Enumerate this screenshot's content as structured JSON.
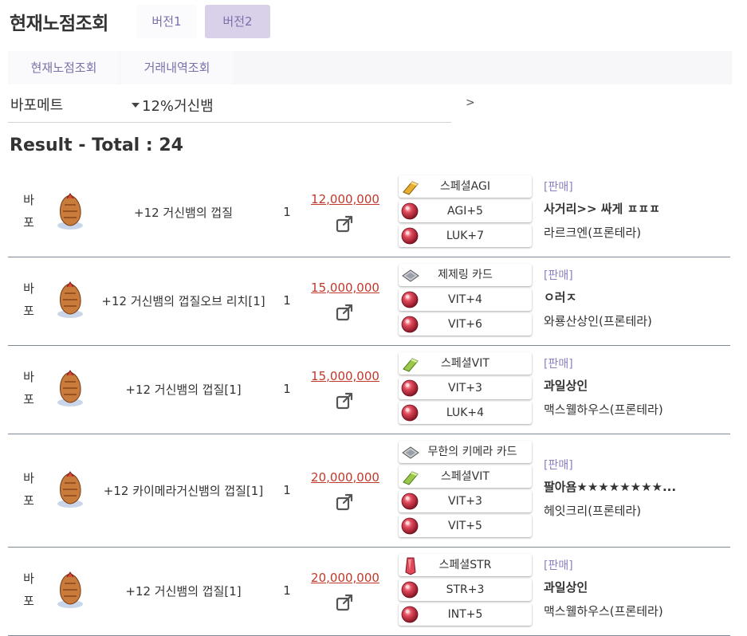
{
  "header": {
    "title": "현재노점조회",
    "version_buttons": [
      "버전1",
      "버전2"
    ]
  },
  "subtabs": [
    "현재노점조회",
    "거래내역조회"
  ],
  "search": {
    "server": "바포메트",
    "query": "12%거신뱀",
    "go": ">"
  },
  "result_label": "Result - Total : 24",
  "rows": [
    {
      "category": [
        "바",
        "포"
      ],
      "item_name": "+12 거신뱀의 껍질",
      "quantity": "1",
      "price": "12,000,000",
      "options": [
        {
          "label": "스페셜AGI",
          "icon": "special-agi-icon"
        },
        {
          "label": "AGI+5",
          "icon": "red-gem-icon"
        },
        {
          "label": "LUK+7",
          "icon": "red-gem-icon"
        }
      ],
      "shop": {
        "tag": "[판매]",
        "name": "사거리>> 싸게 ㅍㅍㅍ",
        "location": "라르크엔(프론테라)"
      }
    },
    {
      "category": [
        "바",
        "포"
      ],
      "item_name": "+12 거신뱀의 껍질오브 리치[1]",
      "quantity": "1",
      "price": "15,000,000",
      "options": [
        {
          "label": "제제링 카드",
          "icon": "card-icon"
        },
        {
          "label": "VIT+4",
          "icon": "red-gem-icon"
        },
        {
          "label": "VIT+6",
          "icon": "red-gem-icon"
        }
      ],
      "shop": {
        "tag": "[판매]",
        "name": "ㅇ러ㅈ",
        "location": "와룡산상인(프론테라)"
      }
    },
    {
      "category": [
        "바",
        "포"
      ],
      "item_name": "+12 거신뱀의 껍질[1]",
      "quantity": "1",
      "price": "15,000,000",
      "options": [
        {
          "label": "스페셜VIT",
          "icon": "special-vit-icon"
        },
        {
          "label": "VIT+3",
          "icon": "red-gem-icon"
        },
        {
          "label": "LUK+4",
          "icon": "red-gem-icon"
        }
      ],
      "shop": {
        "tag": "[판매]",
        "name": "과일상인",
        "location": "맥스웰하우스(프론테라)"
      }
    },
    {
      "category": [
        "바",
        "포"
      ],
      "item_name": "+12 카이메라거신뱀의 껍질[1]",
      "quantity": "1",
      "price": "20,000,000",
      "options": [
        {
          "label": "무한의 키메라 카드",
          "icon": "card-icon"
        },
        {
          "label": "스페셜VIT",
          "icon": "special-vit-icon"
        },
        {
          "label": "VIT+3",
          "icon": "red-gem-icon"
        },
        {
          "label": "VIT+5",
          "icon": "red-gem-icon"
        }
      ],
      "shop": {
        "tag": "[판매]",
        "name": "팔아욤★★★★★★★★...",
        "location": "헤잇크리(프론테라)"
      }
    },
    {
      "category": [
        "바",
        "포"
      ],
      "item_name": "+12 거신뱀의 껍질[1]",
      "quantity": "1",
      "price": "20,000,000",
      "options": [
        {
          "label": "스페셜STR",
          "icon": "special-str-icon"
        },
        {
          "label": "STR+3",
          "icon": "red-gem-icon"
        },
        {
          "label": "INT+5",
          "icon": "red-gem-icon"
        }
      ],
      "shop": {
        "tag": "[판매]",
        "name": "과일상인",
        "location": "맥스웰하우스(프론테라)"
      }
    }
  ]
}
